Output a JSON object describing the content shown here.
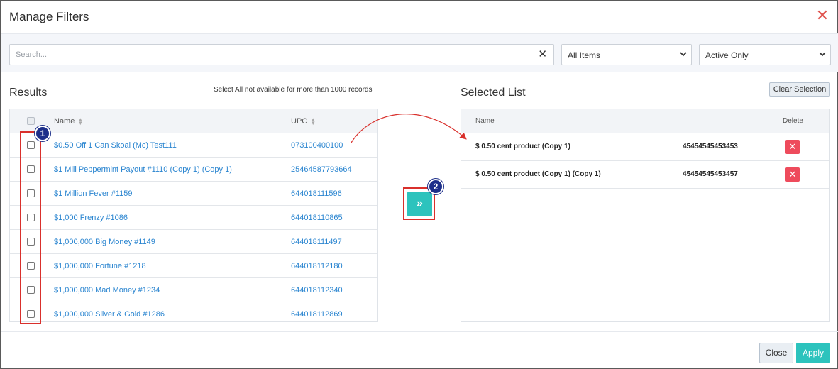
{
  "dialog": {
    "title": "Manage Filters",
    "close_symbol": "✕"
  },
  "filters": {
    "search_placeholder": "Search...",
    "search_clear_symbol": "✕",
    "items_select": "All Items",
    "status_select": "Active Only"
  },
  "results": {
    "title": "Results",
    "note": "Select All not available for more than 1000 records",
    "col_name": "Name",
    "col_upc": "UPC",
    "rows": [
      {
        "name": "$0.50 Off 1 Can Skoal (Mc) Test111",
        "upc": "073100400100"
      },
      {
        "name": "$1 Mill Peppermint Payout #1110 (Copy 1) (Copy 1)",
        "upc": "25464587793664"
      },
      {
        "name": "$1 Million Fever #1159",
        "upc": "644018111596"
      },
      {
        "name": "$1,000 Frenzy #1086",
        "upc": "644018110865"
      },
      {
        "name": "$1,000,000 Big Money #1149",
        "upc": "644018111497"
      },
      {
        "name": "$1,000,000 Fortune #1218",
        "upc": "644018112180"
      },
      {
        "name": "$1,000,000 Mad Money #1234",
        "upc": "644018112340"
      },
      {
        "name": "$1,000,000 Silver & Gold #1286",
        "upc": "644018112869"
      }
    ]
  },
  "callouts": {
    "step1": "1",
    "step2": "2",
    "annotation_color": "#d9302c",
    "badge_color": "#1d2f8a"
  },
  "move_button_symbol": "»",
  "selected": {
    "title": "Selected List",
    "clear_label": "Clear Selection",
    "col_name": "Name",
    "col_delete": "Delete",
    "rows": [
      {
        "name": "$ 0.50 cent product (Copy 1)",
        "upc": "45454545453453"
      },
      {
        "name": "$ 0.50 cent product (Copy 1) (Copy 1)",
        "upc": "45454545453457"
      }
    ],
    "delete_symbol": "✕"
  },
  "footer": {
    "close_label": "Close",
    "apply_label": "Apply"
  },
  "colors": {
    "accent": "#2cc3bd",
    "link": "#2a85d0",
    "delete": "#ee4b5c",
    "close_x": "#e0544f"
  }
}
